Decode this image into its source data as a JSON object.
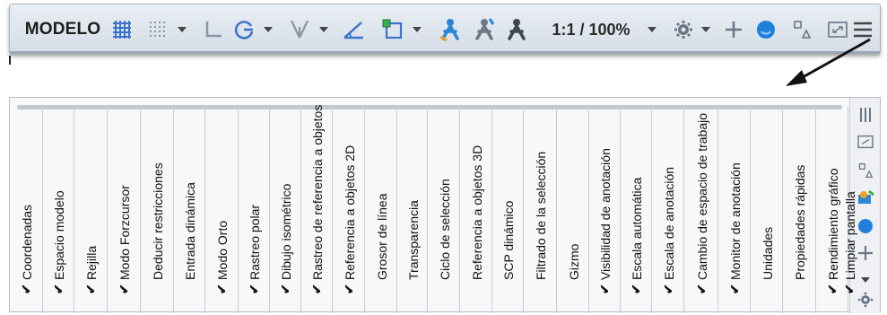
{
  "statusbar": {
    "model_label": "MODELO",
    "scale_label": "1:1 / 100%",
    "icons": [
      "grid-display-icon",
      "snap-mode-icon",
      "dropdown-icon",
      "ortho-mode-icon",
      "polar-tracking-icon",
      "dropdown-icon",
      "isometric-drafting-icon",
      "dropdown-icon",
      "object-snap-tracking-icon",
      "object-snap-icon",
      "dropdown-icon",
      "annotation-visibility-icon",
      "auto-scale-icon",
      "annotation-scale-icon",
      "workspace-gear-icon",
      "dropdown-icon",
      "annotation-monitor-plus-icon",
      "isolate-objects-icon",
      "quick-properties-icon",
      "clean-screen-icon",
      "customization-menu-icon"
    ]
  },
  "customization_menu": {
    "items": [
      {
        "label": "Coordenadas",
        "checked": true
      },
      {
        "label": "Espacio modelo",
        "checked": true
      },
      {
        "label": "Rejilla",
        "checked": true
      },
      {
        "label": "Modo Forzcursor",
        "checked": true
      },
      {
        "label": "Deducir restricciones",
        "checked": false
      },
      {
        "label": "Entrada dinámica",
        "checked": false
      },
      {
        "label": "Modo Orto",
        "checked": true
      },
      {
        "label": "Rastreo polar",
        "checked": true
      },
      {
        "label": "Dibujo isométrico",
        "checked": true
      },
      {
        "label": "Rastreo de referencia a objetos",
        "checked": true
      },
      {
        "label": "Referencia a objetos 2D",
        "checked": true
      },
      {
        "label": "Grosor de línea",
        "checked": false
      },
      {
        "label": "Transparencia",
        "checked": false
      },
      {
        "label": "Ciclo de selección",
        "checked": false
      },
      {
        "label": "Referencia a objetos 3D",
        "checked": false
      },
      {
        "label": "SCP dinámico",
        "checked": false
      },
      {
        "label": "Filtrado de la selección",
        "checked": false
      },
      {
        "label": "Gizmo",
        "checked": false
      },
      {
        "label": "Visibilidad de anotación",
        "checked": true
      },
      {
        "label": "Escala automática",
        "checked": true
      },
      {
        "label": "Escala de anotación",
        "checked": true
      },
      {
        "label": "Cambio de espacio de trabajo",
        "checked": true
      },
      {
        "label": "Monitor de anotación",
        "checked": true
      },
      {
        "label": "Unidades",
        "checked": false
      },
      {
        "label": "Propiedades rápidas",
        "checked": false
      },
      {
        "label": "Rendimiento gráfico",
        "checked": true
      },
      {
        "label": "Limpiar pantalla",
        "checked": true
      }
    ],
    "check_glyph": "✔",
    "side_icons": [
      "menu-lines-icon",
      "clean-screen-icon",
      "quick-properties-icon",
      "graphics-performance-icon",
      "blue-circle-icon",
      "plus-icon",
      "dropdown-icon",
      "gear-icon"
    ]
  },
  "colors": {
    "accent_blue": "#1f7fdc",
    "grid_blue": "#3a73c9",
    "snap_cyan": "#2bb0d8"
  }
}
